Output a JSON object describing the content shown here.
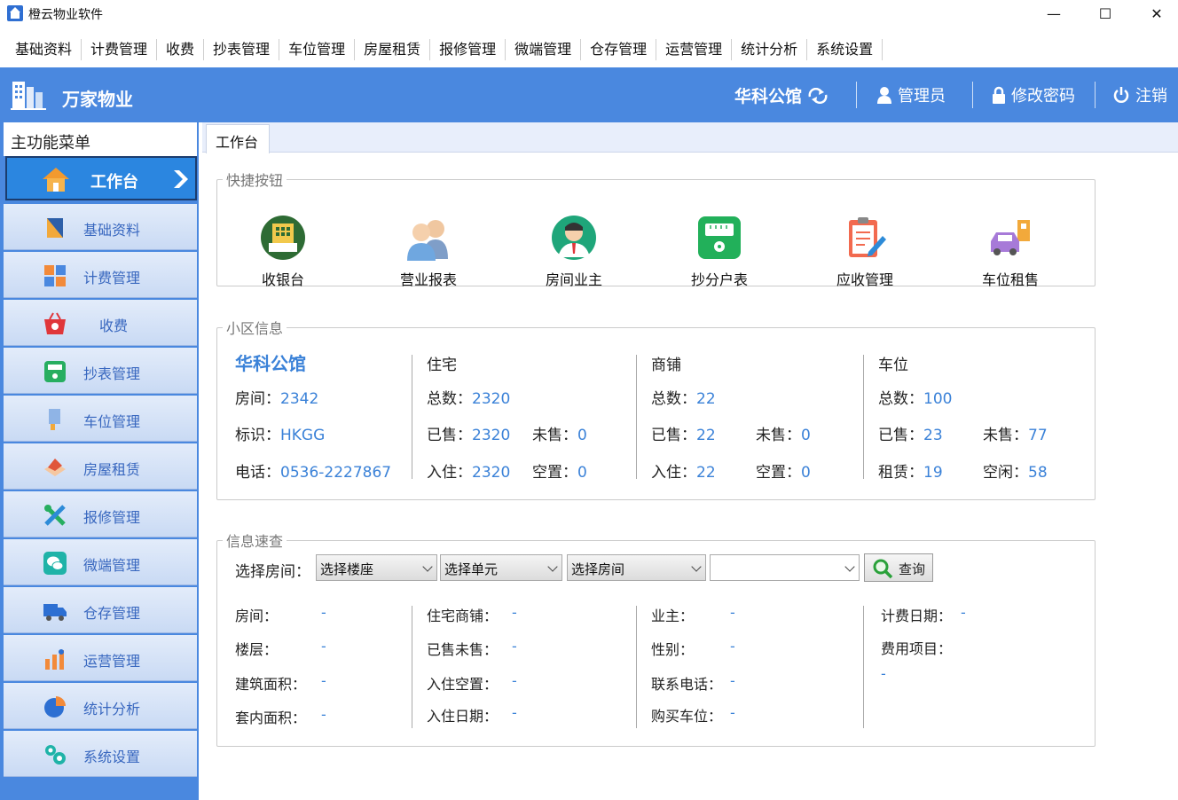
{
  "window": {
    "title": "橙云物业软件",
    "min": "—",
    "max": "☐",
    "close": "✕"
  },
  "menubar": [
    "基础资料",
    "计费管理",
    "收费",
    "抄表管理",
    "车位管理",
    "房屋租赁",
    "报修管理",
    "微端管理",
    "仓存管理",
    "运营管理",
    "统计分析",
    "系统设置"
  ],
  "header": {
    "company": "万家物业",
    "community": "华科公馆",
    "user": "管理员",
    "change_password": "修改密码",
    "logout": "注销",
    "color": "#4a88df"
  },
  "sidebar": {
    "title": "主功能菜单",
    "active": {
      "label": "工作台",
      "icon": "home-icon"
    },
    "items": [
      {
        "label": "基础资料",
        "icon": "folder-icon"
      },
      {
        "label": "计费管理",
        "icon": "calculator-icon"
      },
      {
        "label": "收费",
        "icon": "basket-icon"
      },
      {
        "label": "抄表管理",
        "icon": "meter-icon"
      },
      {
        "label": "车位管理",
        "icon": "parking-icon"
      },
      {
        "label": "房屋租赁",
        "icon": "house-rent-icon"
      },
      {
        "label": "报修管理",
        "icon": "tools-icon"
      },
      {
        "label": "微端管理",
        "icon": "wechat-icon"
      },
      {
        "label": "仓存管理",
        "icon": "truck-icon"
      },
      {
        "label": "运营管理",
        "icon": "operations-icon"
      },
      {
        "label": "统计分析",
        "icon": "pie-chart-icon"
      },
      {
        "label": "系统设置",
        "icon": "gears-icon"
      }
    ]
  },
  "tab": "工作台",
  "quick": {
    "legend": "快捷按钮",
    "buttons": [
      {
        "label": "收银台",
        "icon": "cashier-icon"
      },
      {
        "label": "营业报表",
        "icon": "users-report-icon"
      },
      {
        "label": "房间业主",
        "icon": "owner-icon"
      },
      {
        "label": "抄分户表",
        "icon": "meter-reading-icon"
      },
      {
        "label": "应收管理",
        "icon": "clipboard-icon"
      },
      {
        "label": "车位租售",
        "icon": "car-icon"
      }
    ]
  },
  "community": {
    "legend": "小区信息",
    "name": "华科公馆",
    "room_label": "房间：",
    "room": "2342",
    "code_label": "标识：",
    "code": "HKGG",
    "phone_label": "电话：",
    "phone": "0536-2227867",
    "residential": {
      "title": "住宅",
      "total_label": "总数：",
      "total": "2320",
      "sold_label": "已售：",
      "sold": "2320",
      "unsold_label": "未售：",
      "unsold": "0",
      "occupied_label": "入住：",
      "occupied": "2320",
      "vacant_label": "空置：",
      "vacant": "0"
    },
    "shop": {
      "title": "商铺",
      "total_label": "总数：",
      "total": "22",
      "sold_label": "已售：",
      "sold": "22",
      "unsold_label": "未售：",
      "unsold": "0",
      "occupied_label": "入住：",
      "occupied": "22",
      "vacant_label": "空置：",
      "vacant": "0"
    },
    "parking": {
      "title": "车位",
      "total_label": "总数：",
      "total": "100",
      "sold_label": "已售：",
      "sold": "23",
      "unsold_label": "未售：",
      "unsold": "77",
      "rent_label": "租赁：",
      "rent": "19",
      "idle_label": "空闲：",
      "idle": "58"
    }
  },
  "info": {
    "legend": "信息速查",
    "select_label": "选择房间：",
    "building": "选择楼座",
    "unit": "选择单元",
    "room": "选择房间",
    "extra": "",
    "query": "查询",
    "fields": {
      "room": "房间：",
      "floor": "楼层：",
      "build_area": "建筑面积：",
      "inner_area": "套内面积：",
      "type": "住宅商铺：",
      "sold": "已售未售：",
      "occupied": "入住空置：",
      "move_in": "入住日期：",
      "owner": "业主：",
      "gender": "性别：",
      "contact": "联系电话：",
      "parking": "购买车位：",
      "bill_date": "计费日期：",
      "fee_items": "费用项目："
    },
    "empty": "-"
  }
}
